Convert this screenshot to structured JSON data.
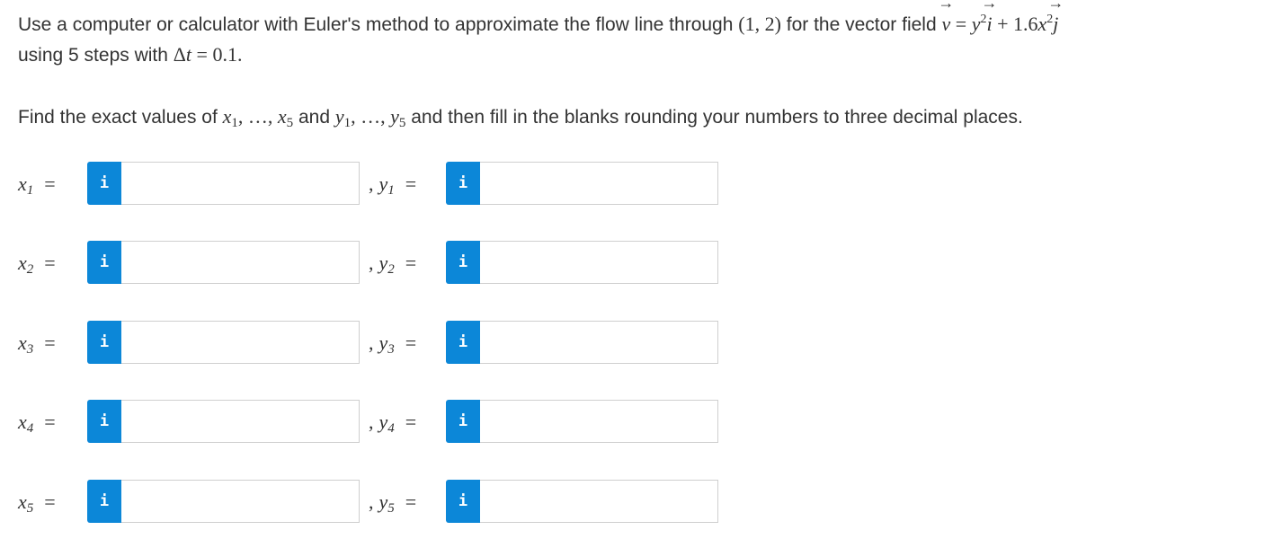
{
  "problem": {
    "t1": "Use a computer or calculator with Euler's method to approximate the flow line through ",
    "point": "(1, 2)",
    "t2": " for the vector field ",
    "v": "v",
    "eq": " = ",
    "y": "y",
    "two": "2",
    "i": "i",
    "plus": " + 1.6",
    "x": "x",
    "j": "j",
    "t3": "using 5 steps with ",
    "delta": "Δ",
    "t": "t",
    "eq2": " = 0.1",
    "dot": "."
  },
  "instruction": {
    "t1": "Find the exact values of ",
    "x": "x",
    "one": "1",
    "ellipsis": ", …, ",
    "five": "5",
    "and": " and ",
    "y": "y",
    "t2": " and then fill in the blanks rounding your numbers to three decimal places."
  },
  "rows": [
    {
      "x_var": "x",
      "y_var": "y",
      "sub": "1",
      "eq": "=",
      "comma": ",",
      "x_value": "",
      "y_value": ""
    },
    {
      "x_var": "x",
      "y_var": "y",
      "sub": "2",
      "eq": "=",
      "comma": ",",
      "x_value": "",
      "y_value": ""
    },
    {
      "x_var": "x",
      "y_var": "y",
      "sub": "3",
      "eq": "=",
      "comma": ",",
      "x_value": "",
      "y_value": ""
    },
    {
      "x_var": "x",
      "y_var": "y",
      "sub": "4",
      "eq": "=",
      "comma": ",",
      "x_value": "",
      "y_value": ""
    },
    {
      "x_var": "x",
      "y_var": "y",
      "sub": "5",
      "eq": "=",
      "comma": ",",
      "x_value": "",
      "y_value": ""
    }
  ],
  "info_button_label": "i",
  "icons": {
    "info": "info-icon"
  },
  "colors": {
    "info_button": "#0c87d8",
    "field_border": "#cfcfcf",
    "text": "#333333"
  }
}
